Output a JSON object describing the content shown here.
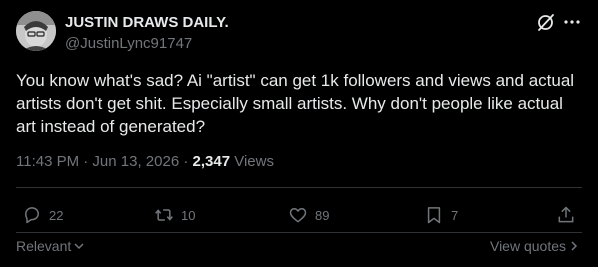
{
  "author": {
    "display_name": "JUSTIN DRAWS DAILY.",
    "handle": "@JustinLync91747"
  },
  "tweet": {
    "text": "You know what's sad? Ai \"artist\" can get 1k followers and views and actual artists don't get shit. Especially small artists. Why don't people like actual art instead of generated?",
    "time_date": "11:43 PM · Jun 13, 2026 · ",
    "views_count": "2,347",
    "views_label": " Views"
  },
  "actions": {
    "replies": "22",
    "reposts": "10",
    "likes": "89",
    "bookmarks": "7"
  },
  "footer": {
    "sort_label": "Relevant",
    "view_quotes_label": "View quotes"
  },
  "icons": [
    "grok-icon",
    "more-icon",
    "reply-icon",
    "repost-icon",
    "like-icon",
    "bookmark-icon",
    "share-icon",
    "chevron-down-icon",
    "chevron-right-icon"
  ],
  "colors": {
    "background": "#000000",
    "text": "#e7e9ea",
    "muted": "#71767b",
    "divider": "#2f3336"
  }
}
